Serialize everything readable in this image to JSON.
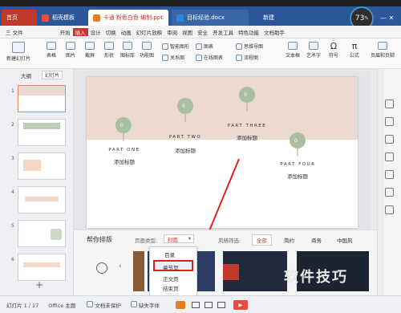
{
  "window": {
    "tabs": [
      {
        "label": "首页"
      },
      {
        "label": "稻壳模板"
      },
      {
        "label": "卡通 粉色白色 编制.pptx"
      },
      {
        "label": "目标经验.docx"
      },
      {
        "label": "新建"
      }
    ],
    "speed_badge": "73",
    "speed_unit": "%"
  },
  "menu": {
    "file": "三 文件",
    "items": [
      "开始",
      "插入",
      "设计",
      "切换",
      "动画",
      "幻灯片放映",
      "审阅",
      "视图",
      "安全",
      "开发工具",
      "特色功能",
      "文档助手"
    ],
    "active_index": 1
  },
  "ribbon": {
    "new_slide": "新建幻灯片",
    "table": "表格",
    "picture": "图片",
    "screenshot": "截屏",
    "shape": "形状",
    "icon_lib": "图标库",
    "func_graph": "功能图",
    "smart_graphic": "智能图形",
    "relationship": "关系图",
    "chart": "图表",
    "online_chart": "在线图表",
    "mindmap": "思维导图",
    "flowchart": "流程图",
    "textbox": "文本框",
    "art_text": "艺术字",
    "symbol": "符号",
    "formula": "公式",
    "header_footer": "页眉和页脚"
  },
  "leftpanel": {
    "tab_outline": "大纲",
    "tab_slides": "幻灯片",
    "numbers": [
      "1",
      "2",
      "3",
      "4",
      "5",
      "6"
    ]
  },
  "slide": {
    "parts": [
      {
        "title": "PART ONE",
        "sub": "添加标题",
        "num": "0"
      },
      {
        "title": "PART TWO",
        "sub": "添加标题",
        "num": "0"
      },
      {
        "title": "PART THREE",
        "sub": "添加标题",
        "num": "0"
      },
      {
        "title": "PART FOUR",
        "sub": "添加标题",
        "num": "0"
      }
    ]
  },
  "bottom": {
    "title": "帮你排版",
    "page_type_label": "页面类型:",
    "page_type_value": "封面",
    "style_label": "风格筛选:",
    "filters": [
      "全部",
      "简约",
      "商务",
      "中国风"
    ],
    "dropdown": [
      "目录",
      "章节页",
      "正文页",
      "结束页"
    ]
  },
  "status": {
    "slide_info": "幻灯片 1 / 17",
    "theme": "Office 主题",
    "doc_protect": "文档未保护",
    "missing_font": "缺失字体"
  },
  "watermark": "软件技巧",
  "colors": {
    "accent": "#c0392b",
    "slide_top": "#ecd9cf",
    "circle": "#a9c0a0"
  }
}
